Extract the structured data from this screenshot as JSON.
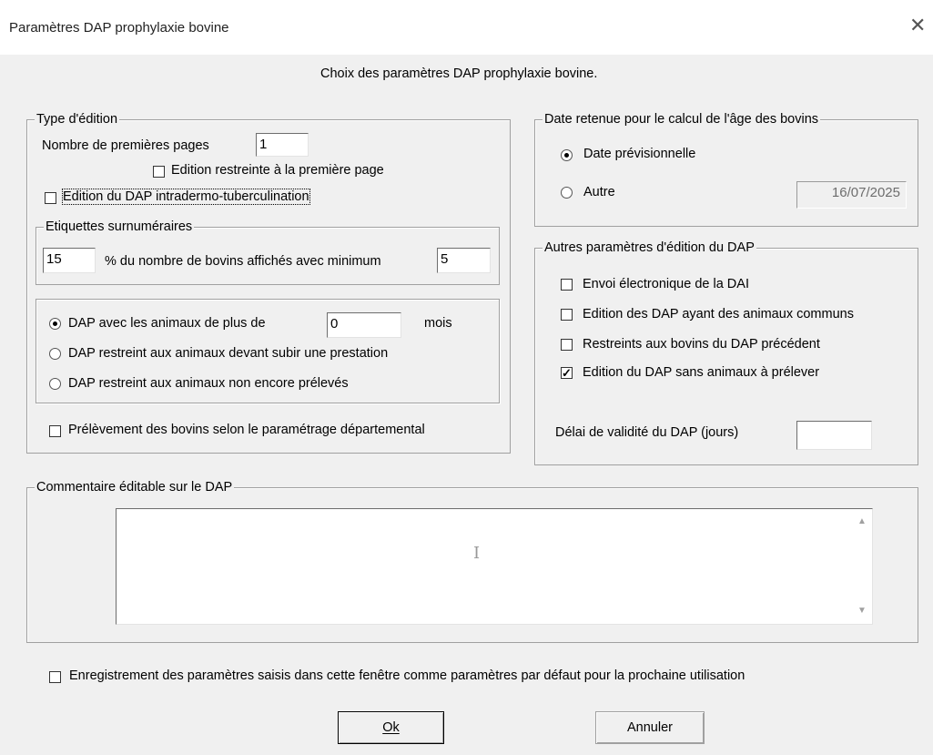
{
  "window": {
    "title": "Paramètres DAP prophylaxie bovine",
    "close_glyph": "✕"
  },
  "header": {
    "text": "Choix des paramètres DAP prophylaxie bovine."
  },
  "type_edition": {
    "legend": "Type d'édition",
    "nb_pages_label": "Nombre de premières pages",
    "nb_pages_value": "1",
    "restreinte_label": "Edition restreinte à la première page",
    "restreinte_checked": false,
    "intradermo_label": "Edition du DAP intradermo-tuberculination",
    "intradermo_checked": false
  },
  "etiquettes": {
    "legend": "Etiquettes surnuméraires",
    "percent_value": "15",
    "percent_label": "% du nombre de bovins affichés avec minimum",
    "minimum_value": "5"
  },
  "dap_options": {
    "selected": 0,
    "option1_label": "DAP avec les animaux de plus de",
    "months_value": "0",
    "months_unit": "mois",
    "option2_label": "DAP restreint aux animaux devant subir une prestation",
    "option3_label": "DAP restreint aux animaux non encore prélevés"
  },
  "prelevement": {
    "label": "Prélèvement des bovins selon le paramétrage départemental",
    "checked": false
  },
  "date_group": {
    "legend": "Date retenue pour le calcul de l'âge des bovins",
    "option1_label": "Date prévisionnelle",
    "option2_label": "Autre",
    "selected": 0,
    "date_value": "16/07/2025"
  },
  "autres": {
    "legend": "Autres paramètres d'édition du DAP",
    "envoi_label": "Envoi électronique de la DAI",
    "envoi_checked": false,
    "communs_label": "Edition des DAP ayant des animaux communs",
    "communs_checked": false,
    "restreints_label": "Restreints aux bovins du DAP précédent",
    "restreints_checked": false,
    "sans_animaux_label": "Edition du DAP sans animaux à prélever",
    "sans_animaux_checked": true,
    "delai_label": "Délai de validité du DAP (jours)",
    "delai_value": ""
  },
  "commentaire": {
    "legend": "Commentaire éditable sur le DAP",
    "value": ""
  },
  "enregistrement": {
    "label": "Enregistrement des paramètres saisis dans cette fenêtre comme paramètres par défaut pour la prochaine utilisation",
    "checked": false
  },
  "buttons": {
    "ok_label": "Ok",
    "annuler_label": "Annuler"
  },
  "check_glyph": "✓"
}
